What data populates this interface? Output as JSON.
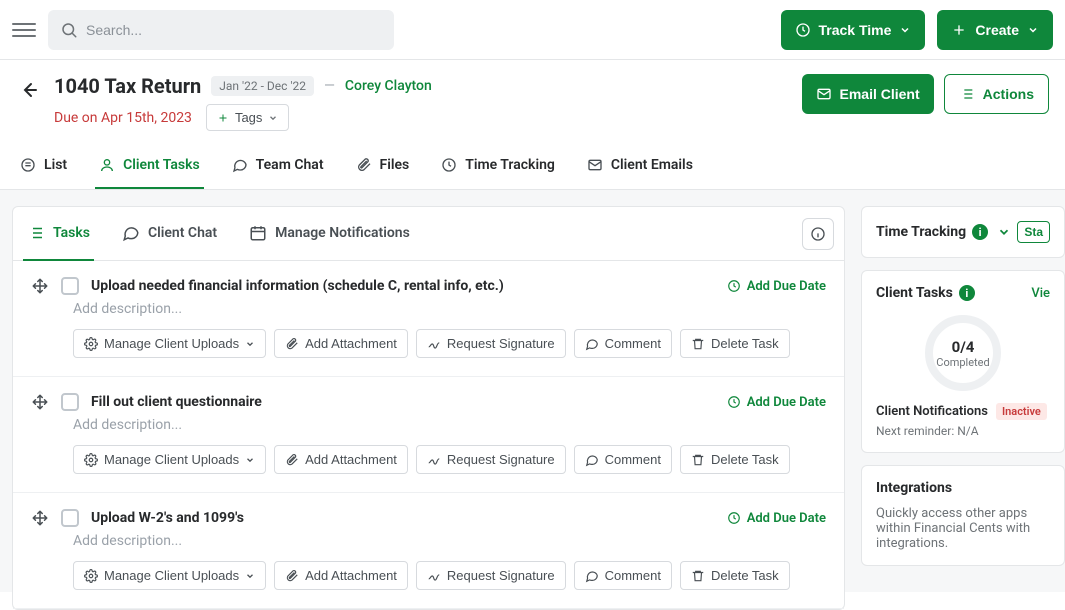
{
  "search": {
    "placeholder": "Search..."
  },
  "topbar": {
    "track_time": "Track Time",
    "create": "Create"
  },
  "header": {
    "title": "1040 Tax Return",
    "period": "Jan '22 - Dec '22",
    "client": "Corey Clayton",
    "due": "Due on Apr 15th, 2023",
    "tags_label": "Tags",
    "email_client": "Email Client",
    "actions": "Actions"
  },
  "main_tabs": {
    "list": "List",
    "client_tasks": "Client Tasks",
    "team_chat": "Team Chat",
    "files": "Files",
    "time_tracking": "Time Tracking",
    "client_emails": "Client Emails"
  },
  "panel_tabs": {
    "tasks": "Tasks",
    "client_chat": "Client Chat",
    "manage_notifications": "Manage Notifications"
  },
  "task_actions": {
    "manage_uploads": "Manage Client Uploads",
    "add_attachment": "Add Attachment",
    "request_signature": "Request Signature",
    "comment": "Comment",
    "delete_task": "Delete Task",
    "add_due_date": "Add Due Date",
    "add_description": "Add description..."
  },
  "tasks": [
    {
      "title": "Upload needed financial information (schedule C, rental info, etc.)"
    },
    {
      "title": "Fill out client questionnaire"
    },
    {
      "title": "Upload W-2's and 1099's"
    }
  ],
  "side": {
    "time_tracking": "Time Tracking",
    "start": "Sta",
    "client_tasks": "Client Tasks",
    "view": "Vie",
    "progress_value": "0/4",
    "progress_label": "Completed",
    "client_notifications": "Client Notifications",
    "inactive": "Inactive",
    "next_reminder": "Next reminder: N/A",
    "integrations": "Integrations",
    "integrations_desc": "Quickly access other apps within Financial Cents with integrations."
  }
}
